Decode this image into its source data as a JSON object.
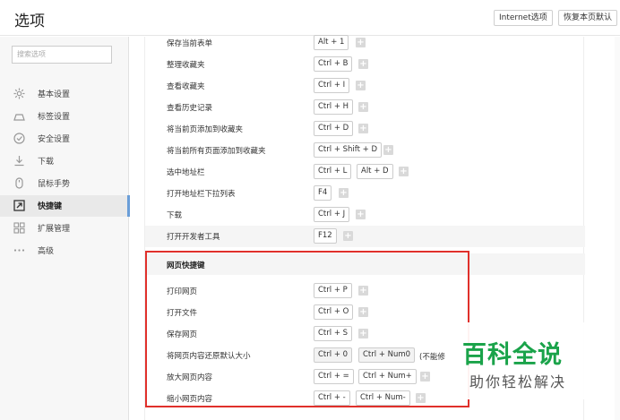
{
  "header": {
    "title": "选项",
    "internet_btn": "Internet选项",
    "reset_btn": "恢复本页默认"
  },
  "sidebar": {
    "search_placeholder": "搜索选项",
    "items": [
      {
        "label": "基本设置",
        "icon": "gear-icon"
      },
      {
        "label": "标签设置",
        "icon": "tab-icon"
      },
      {
        "label": "安全设置",
        "icon": "shield-check-icon"
      },
      {
        "label": "下载",
        "icon": "download-icon"
      },
      {
        "label": "鼠标手势",
        "icon": "mouse-icon"
      },
      {
        "label": "快捷键",
        "icon": "shortcut-icon"
      },
      {
        "label": "扩展管理",
        "icon": "extensions-icon"
      },
      {
        "label": "高级",
        "icon": "more-icon"
      }
    ],
    "active_index": 5
  },
  "shortcuts": {
    "rows": [
      {
        "name": "保存当前表单",
        "keys": [
          "Alt + 1"
        ]
      },
      {
        "name": "整理收藏夹",
        "keys": [
          "Ctrl + B"
        ]
      },
      {
        "name": "查看收藏夹",
        "keys": [
          "Ctrl + I"
        ]
      },
      {
        "name": "查看历史记录",
        "keys": [
          "Ctrl + H"
        ]
      },
      {
        "name": "将当前页添加到收藏夹",
        "keys": [
          "Ctrl + D"
        ]
      },
      {
        "name": "将当前所有页面添加到收藏夹",
        "keys": [
          "Ctrl + Shift + D"
        ]
      },
      {
        "name": "选中地址栏",
        "keys": [
          "Ctrl + L",
          "Alt + D"
        ]
      },
      {
        "name": "打开地址栏下拉列表",
        "keys": [
          "F4"
        ]
      },
      {
        "name": "下载",
        "keys": [
          "Ctrl + J"
        ]
      },
      {
        "name": "打开开发者工具",
        "keys": [
          "F12"
        ]
      }
    ],
    "web_section_title": "网页快捷键",
    "web_rows": [
      {
        "name": "打印网页",
        "keys": [
          "Ctrl + P"
        ]
      },
      {
        "name": "打开文件",
        "keys": [
          "Ctrl + O"
        ]
      },
      {
        "name": "保存网页",
        "keys": [
          "Ctrl + S"
        ]
      },
      {
        "name": "将网页内容还原默认大小",
        "keys": [
          "Ctrl + 0",
          "Ctrl + Num0"
        ],
        "note": "(不能修"
      },
      {
        "name": "放大网页内容",
        "keys": [
          "Ctrl + =",
          "Ctrl + Num+"
        ]
      },
      {
        "name": "缩小网页内容",
        "keys": [
          "Ctrl + -",
          "Ctrl + Num-"
        ]
      }
    ],
    "plus_label": "+"
  },
  "watermark": {
    "logo": "百科全说",
    "sub": "助你轻松解决"
  },
  "colors": {
    "accent": "#6a9ed8",
    "highlight_box": "#e0302b",
    "watermark_green": "#1aa34a"
  }
}
